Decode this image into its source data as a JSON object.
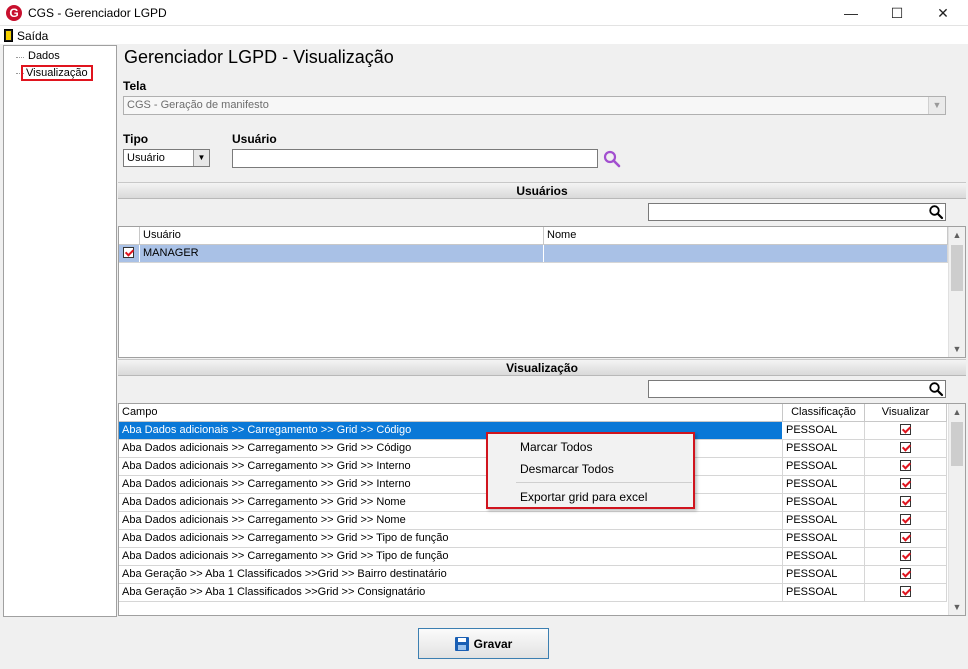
{
  "window": {
    "title": "CGS - Gerenciador LGPD",
    "icon_letter": "G",
    "minimize_glyph": "—",
    "maximize_glyph": "☐",
    "close_glyph": "✕",
    "accent": "#c8102e"
  },
  "menu": {
    "exit_label": "Saída"
  },
  "tree": {
    "items": [
      "Dados",
      "Visualização"
    ],
    "selected_index": 1
  },
  "page": {
    "title": "Gerenciador LGPD - Visualização",
    "tela_label": "Tela",
    "tela_value": "CGS - Geração de manifesto",
    "tipo_label": "Tipo",
    "tipo_value": "Usuário",
    "usuario_label": "Usuário",
    "usuario_value": ""
  },
  "usuarios": {
    "section_title": "Usuários",
    "filter_value": "",
    "columns": [
      "Usuário",
      "Nome"
    ],
    "rows": [
      {
        "checked": true,
        "usuario": "MANAGER",
        "nome": ""
      }
    ]
  },
  "visualizacao": {
    "section_title": "Visualização",
    "filter_value": "",
    "columns": [
      "Campo",
      "Classificação",
      "Visualizar"
    ],
    "rows": [
      {
        "campo": "Aba Dados adicionais >> Carregamento >> Grid >> Código",
        "classificacao": "PESSOAL",
        "visualizar": true
      },
      {
        "campo": "Aba Dados adicionais >> Carregamento >> Grid >> Código",
        "classificacao": "PESSOAL",
        "visualizar": true
      },
      {
        "campo": "Aba Dados adicionais >> Carregamento >> Grid >> Interno",
        "classificacao": "PESSOAL",
        "visualizar": true
      },
      {
        "campo": "Aba Dados adicionais >> Carregamento >> Grid >> Interno",
        "classificacao": "PESSOAL",
        "visualizar": true
      },
      {
        "campo": "Aba Dados adicionais >> Carregamento >> Grid >> Nome",
        "classificacao": "PESSOAL",
        "visualizar": true
      },
      {
        "campo": "Aba Dados adicionais >> Carregamento >> Grid >> Nome",
        "classificacao": "PESSOAL",
        "visualizar": true
      },
      {
        "campo": "Aba Dados adicionais >> Carregamento >> Grid >> Tipo de função",
        "classificacao": "PESSOAL",
        "visualizar": true
      },
      {
        "campo": "Aba Dados adicionais >> Carregamento >> Grid >> Tipo de função",
        "classificacao": "PESSOAL",
        "visualizar": true
      },
      {
        "campo": "Aba Geração >> Aba 1 Classificados >>Grid >> Bairro destinatário",
        "classificacao": "PESSOAL",
        "visualizar": true
      },
      {
        "campo": "Aba Geração >> Aba 1 Classificados >>Grid >> Consignatário",
        "classificacao": "PESSOAL",
        "visualizar": true
      }
    ],
    "selected_index": 0
  },
  "context_menu": {
    "items": [
      "Marcar Todos",
      "Desmarcar Todos",
      "Exportar grid para excel"
    ]
  },
  "footer": {
    "save_label": "Gravar"
  },
  "icons": {
    "search": "magnifier-icon",
    "filter": "magnifier-icon",
    "save": "floppy-disk-icon"
  },
  "colors": {
    "selection_user": "#a9c1e6",
    "selection_field": "#0a78d7",
    "highlight_border": "#e0141e",
    "check_mark": "#e0141e"
  }
}
